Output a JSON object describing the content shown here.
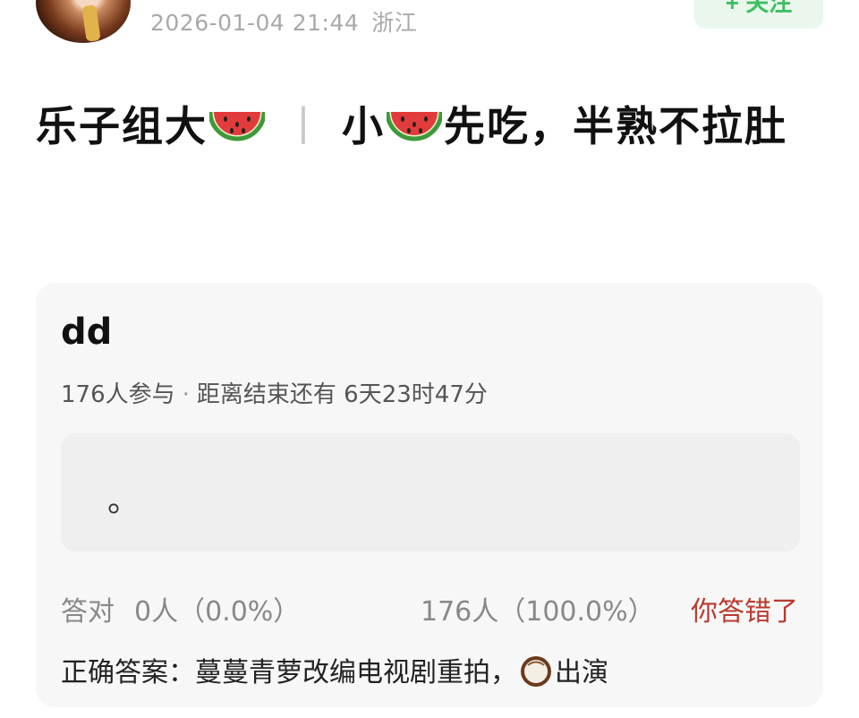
{
  "header": {
    "datetime": "2026-01-04 21:44",
    "location": "浙江",
    "follow_label": "+ 关注"
  },
  "post": {
    "title_part1": "乐子组大",
    "title_separator": "丨",
    "title_part2": "小",
    "title_part3": "先吃，半熟不拉肚",
    "emoji_1": "watermelon-emoji",
    "emoji_2": "watermelon-emoji"
  },
  "poll": {
    "name": "dd",
    "participants": "176人参与",
    "dot": "·",
    "countdown": "距离结束还有 6天23时47分",
    "option_text": "。",
    "correct_label": "答对",
    "correct_count": "0人（0.0%）",
    "wrong_count": "176人（100.0%）",
    "status": "你答错了",
    "answer_prefix": "正确答案：蔓蔓青萝改编电视剧重拍，",
    "answer_emoji": "coconut-emoji",
    "answer_suffix": "出演"
  },
  "colors": {
    "follow_bg": "#eaf7ec",
    "follow_text": "#3fbf62",
    "status_red": "#b93a2e",
    "card_bg": "#f7f7f7"
  }
}
